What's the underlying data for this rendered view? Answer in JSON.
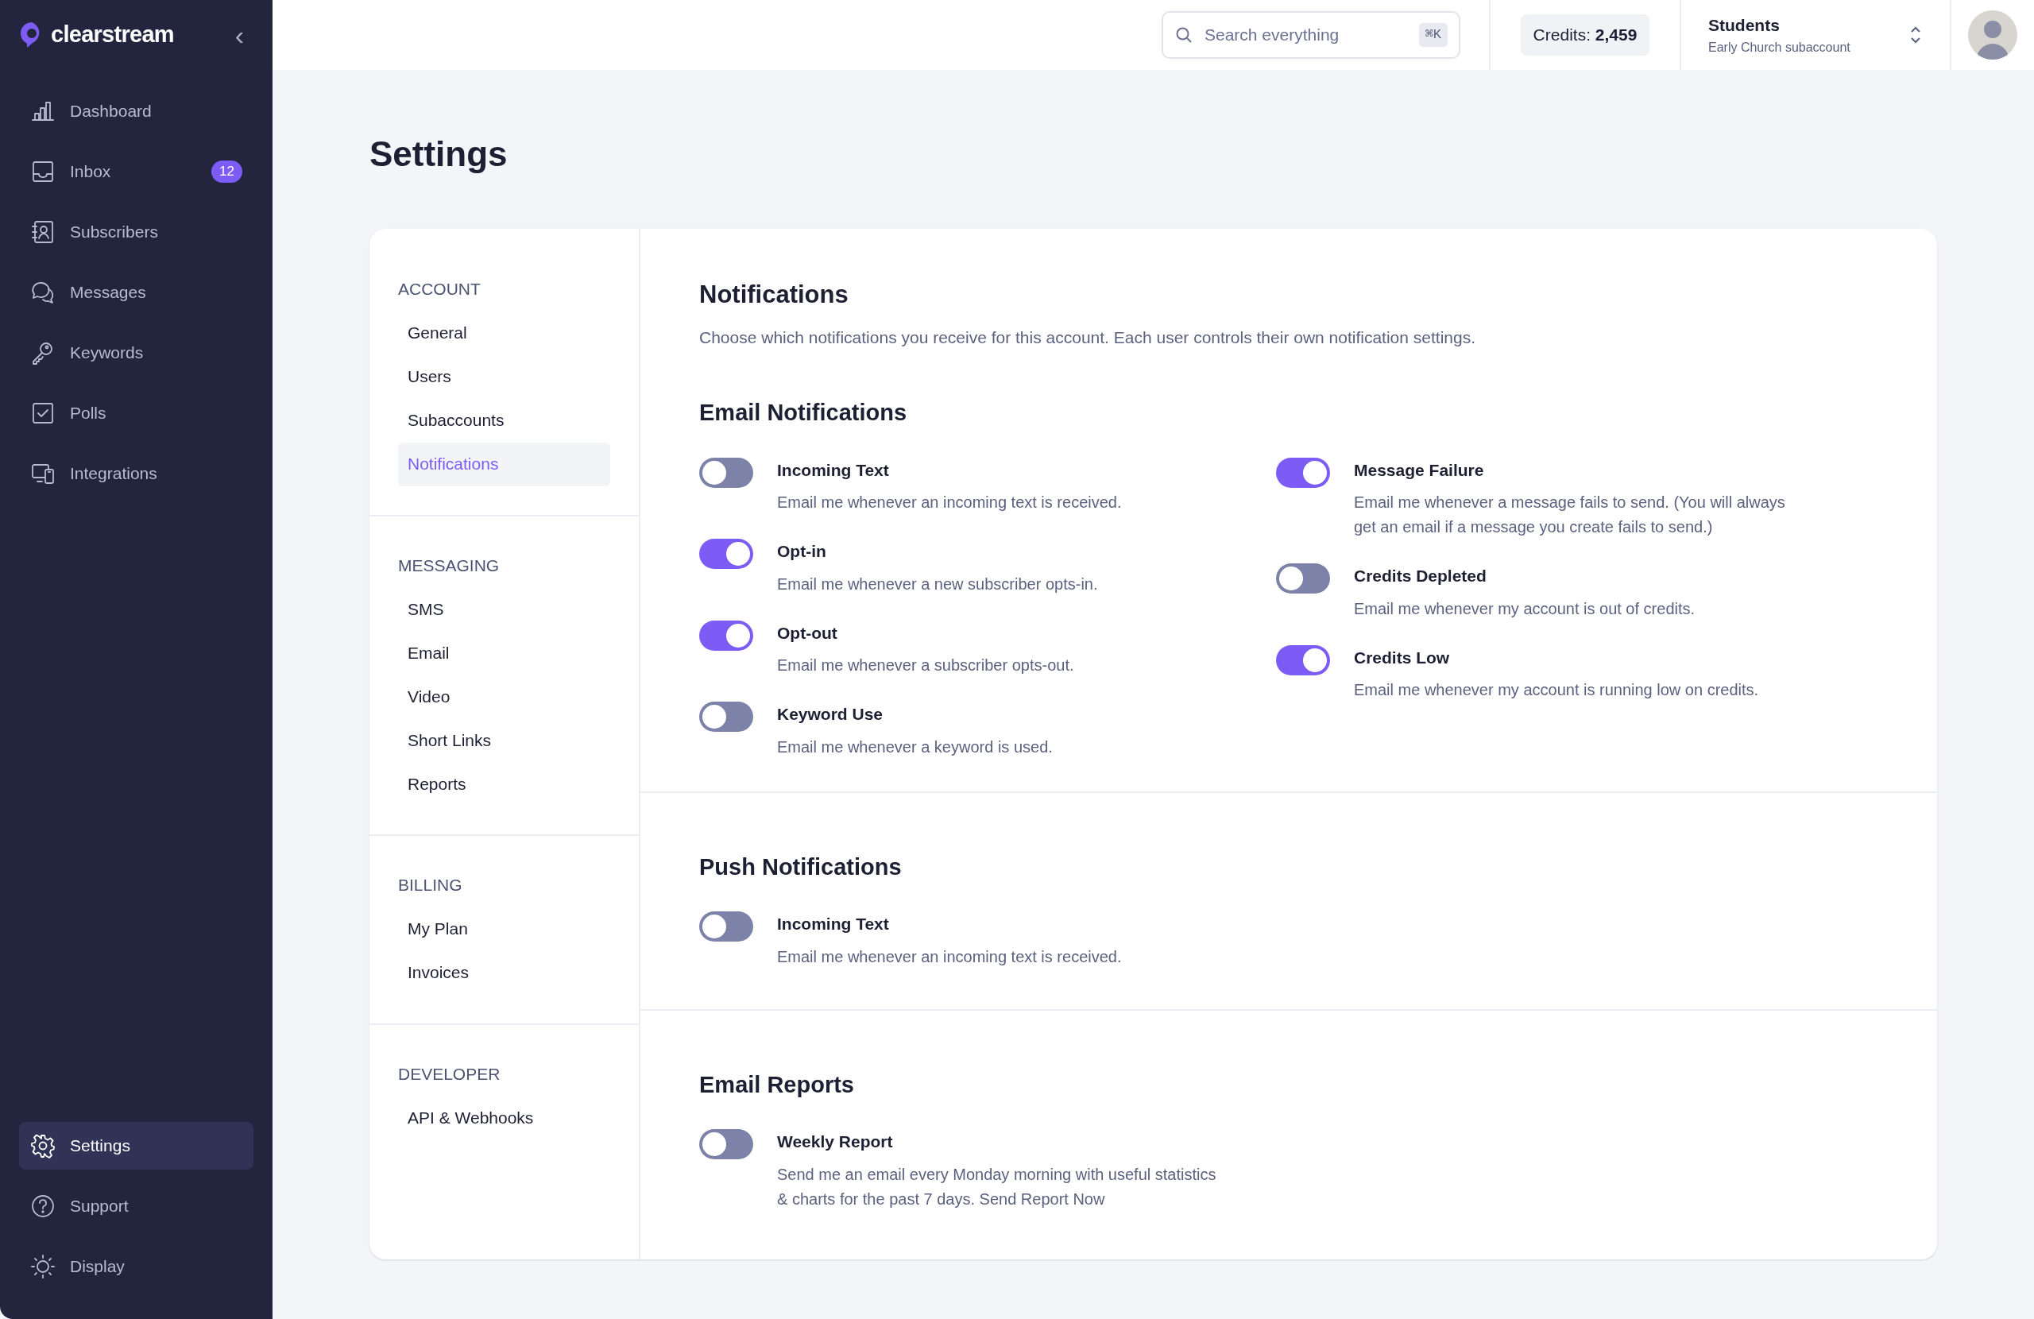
{
  "sidebar": {
    "logo": "clearstream",
    "collapse_glyph": "‹",
    "items": [
      {
        "label": "Dashboard",
        "selected": false
      },
      {
        "label": "Inbox",
        "selected": false,
        "badge": "12"
      },
      {
        "label": "Subscribers",
        "selected": false
      },
      {
        "label": "Messages",
        "selected": false
      },
      {
        "label": "Keywords",
        "selected": false
      },
      {
        "label": "Polls",
        "selected": false
      },
      {
        "label": "Integrations",
        "selected": false
      }
    ],
    "bottom_items": [
      {
        "label": "Settings",
        "selected": true
      },
      {
        "label": "Support",
        "selected": false
      },
      {
        "label": "Display",
        "selected": false
      }
    ]
  },
  "top_bar": {
    "search": {
      "placeholder": "Search everything",
      "shortcut": "⌘K"
    },
    "credits": {
      "label": "Credits:",
      "value": "2,459"
    },
    "account": {
      "name": "Students",
      "subtitle": "Early Church subaccount"
    }
  },
  "page_title": "Settings",
  "settings_nav": [
    {
      "heading": "ACCOUNT",
      "items": [
        {
          "label": "General",
          "selected": false
        },
        {
          "label": "Users",
          "selected": false
        },
        {
          "label": "Subaccounts",
          "selected": false
        },
        {
          "label": "Notifications",
          "selected": true
        }
      ]
    },
    {
      "heading": "MESSAGING",
      "items": [
        {
          "label": "SMS",
          "selected": false
        },
        {
          "label": "Email",
          "selected": false
        },
        {
          "label": "Video",
          "selected": false
        },
        {
          "label": "Short Links",
          "selected": false
        },
        {
          "label": "Reports",
          "selected": false
        }
      ]
    },
    {
      "heading": "BILLING",
      "items": [
        {
          "label": "My Plan",
          "selected": false
        },
        {
          "label": "Invoices",
          "selected": false
        }
      ]
    },
    {
      "heading": "DEVELOPER",
      "items": [
        {
          "label": "API & Webhooks",
          "selected": false
        }
      ]
    }
  ],
  "content": {
    "title": "Notifications",
    "description": "Choose which notifications you receive for this account. Each user controls their own notification settings.",
    "sections": [
      {
        "heading": "Email Notifications",
        "columns": [
          [
            {
              "title": "Incoming Text",
              "description": "Email me whenever an incoming text is received.",
              "on": false
            },
            {
              "title": "Opt-in",
              "description": "Email me whenever a new subscriber opts-in.",
              "on": true
            },
            {
              "title": "Opt-out",
              "description": "Email me whenever a subscriber opts-out.",
              "on": true
            },
            {
              "title": "Keyword Use",
              "description": "Email me whenever a keyword is used.",
              "on": false
            }
          ],
          [
            {
              "title": "Message Failure",
              "description": "Email me whenever a message fails to send. (You will always get an email if a message you create fails to send.)",
              "on": true
            },
            {
              "title": "Credits Depleted",
              "description": "Email me whenever my account is out of credits.",
              "on": false
            },
            {
              "title": "Credits Low",
              "description": "Email me whenever my account is running low on credits.",
              "on": true
            }
          ]
        ]
      },
      {
        "heading": "Push Notifications",
        "columns": [
          [
            {
              "title": "Incoming Text",
              "description": "Email me whenever an incoming text is received.",
              "on": false
            }
          ]
        ]
      },
      {
        "heading": "Email Reports",
        "columns": [
          [
            {
              "title": "Weekly Report",
              "description": "Send me an email every Monday morning with useful statistics & charts for the past 7 days. Send Report Now",
              "on": false
            }
          ]
        ]
      }
    ]
  }
}
